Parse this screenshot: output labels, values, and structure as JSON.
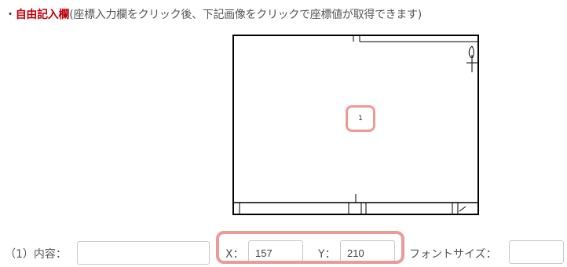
{
  "header": {
    "bullet": "・",
    "title": "自由記入欄",
    "instruction": "(座標入力欄をクリック後、下記画像をクリックで座標値が取得できます)"
  },
  "diagram": {
    "marker_number": "1"
  },
  "row1": {
    "content_label": "（1）内容：",
    "content_value": "",
    "x_label": "X：",
    "x_value": "157",
    "y_label": "Y：",
    "y_value": "210",
    "font_size_label": "フォントサイズ：",
    "font_size_value": ""
  },
  "colors": {
    "accent_red": "#c0000c",
    "highlight_pink": "#ec9a98"
  }
}
